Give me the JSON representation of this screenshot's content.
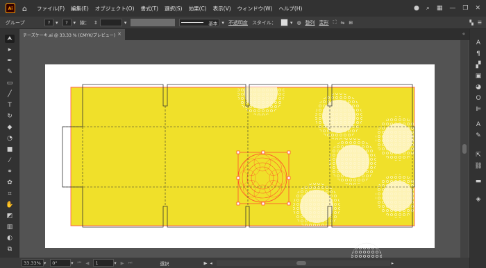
{
  "titlebar": {
    "logo": "Ai",
    "menu": [
      "ファイル(F)",
      "編集(E)",
      "オブジェクト(O)",
      "書式(T)",
      "選択(S)",
      "効果(C)",
      "表示(V)",
      "ウィンドウ(W)",
      "ヘルプ(H)"
    ]
  },
  "control": {
    "selection_label": "グループ",
    "fill_value": "?",
    "stroke_value": "?",
    "stroke_label": "線：",
    "brush_label": "基本",
    "opacity_label": "不透明度",
    "style_label": "スタイル：",
    "align_label": "整列",
    "transform_label": "変形"
  },
  "document": {
    "tab_title": "チーズケーキ.ai @ 33.33 % (CMYK/プレビュー)",
    "close": "×"
  },
  "status": {
    "zoom": "33.33%",
    "rotation": "0°",
    "artboard": "1",
    "mode": "選択"
  },
  "colors": {
    "artwork_yellow": "#f0e02a",
    "selection_red": "#ff3b30",
    "doily_white": "#ffffff"
  }
}
